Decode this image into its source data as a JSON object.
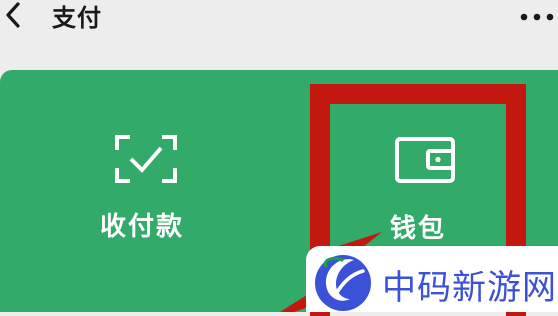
{
  "header": {
    "back_icon": "chevron-left-icon",
    "title": "支付",
    "more_icon": "more-horizontal-icon"
  },
  "payment_panel": {
    "background_color": "#31aa6a",
    "tiles": [
      {
        "label": "收付款",
        "icon": "scan-check-icon"
      },
      {
        "label": "钱包",
        "icon": "wallet-icon"
      }
    ]
  },
  "annotation": {
    "highlight_color": "#c2180f",
    "highlighted_tile": "钱包"
  },
  "watermark": {
    "text": "中码新游网",
    "logo_icon": "site-logo-icon",
    "text_color": "#3b52d8"
  }
}
